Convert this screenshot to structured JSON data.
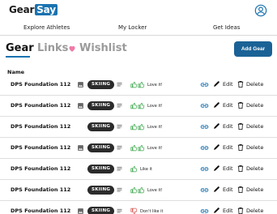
{
  "header": {
    "logo_part1": "Gear",
    "logo_part2": "Say",
    "account_icon": "account-circle-icon"
  },
  "nav": {
    "items": [
      {
        "label": "Explore Athletes"
      },
      {
        "label": "My Locker"
      },
      {
        "label": "Get Ideas"
      }
    ]
  },
  "tabs": {
    "gear": "Gear",
    "links": "Links",
    "wishlist": "Wishlist"
  },
  "add_gear_label": "Add Gear",
  "table": {
    "header_name": "Name",
    "edit_label": "Edit",
    "delete_label": "Delete",
    "rows": [
      {
        "name": "DPS Foundation 112",
        "tag": "SKIING",
        "rating_label": "Love it!",
        "rating": "love",
        "has_image": true
      },
      {
        "name": "DPS Foundation 112",
        "tag": "SKIING",
        "rating_label": "Love it!",
        "rating": "love",
        "has_image": true
      },
      {
        "name": "DPS Foundation 112",
        "tag": "SKIING",
        "rating_label": "Love it!",
        "rating": "love",
        "has_image": false
      },
      {
        "name": "DPS Foundation 112",
        "tag": "SKIING",
        "rating_label": "Love it!",
        "rating": "love",
        "has_image": true
      },
      {
        "name": "DPS Foundation 112",
        "tag": "SKIING",
        "rating_label": "Like it",
        "rating": "like",
        "has_image": false
      },
      {
        "name": "DPS Foundation 112",
        "tag": "SKIING",
        "rating_label": "Love it!",
        "rating": "love",
        "has_image": false
      },
      {
        "name": "DPS Foundation 112",
        "tag": "SKIING",
        "rating_label": "Don't like it",
        "rating": "dislike",
        "has_image": true
      }
    ]
  },
  "colors": {
    "accent": "#1a73b0",
    "button": "#1a6296",
    "thumb_up": "#3aa64a",
    "thumb_down": "#d9534f",
    "heart": "#ef7aa7"
  }
}
